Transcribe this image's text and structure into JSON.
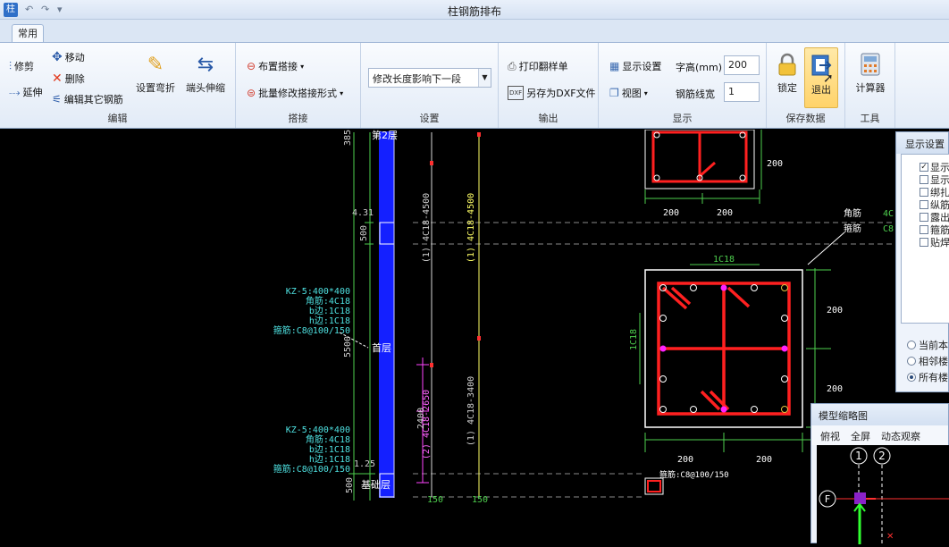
{
  "window": {
    "title": "柱钢筋排布"
  },
  "tabs": {
    "home": "常用"
  },
  "ribbon": {
    "edit": {
      "label": "编辑",
      "trim": "修剪",
      "move": "移动",
      "extend": "延伸",
      "delete": "删除",
      "edit_other": "编辑其它钢筋",
      "set_bend": "设置弯折",
      "end_stretch": "端头伸缩"
    },
    "lap": {
      "label": "搭接",
      "place": "布置搭接",
      "batch": "批量修改搭接形式"
    },
    "settings": {
      "label": "设置",
      "combo_value": "修改长度影响下一段"
    },
    "output": {
      "label": "输出",
      "print": "打印翻样单",
      "save_dxf": "另存为DXF文件"
    },
    "display": {
      "label": "显示",
      "show_settings": "显示设置",
      "view": "视图",
      "font_height_label": "字高(mm)",
      "font_height": "200",
      "line_width_label": "钢筋线宽",
      "line_width": "1"
    },
    "save": {
      "label": "保存数据",
      "lock": "锁定",
      "exit": "退出"
    },
    "tools": {
      "label": "工具",
      "calculator": "计算器"
    }
  },
  "display_panel": {
    "title": "显示设置",
    "items": [
      "显示",
      "显示",
      "绑扎",
      "纵筋",
      "露出",
      "箍筋",
      "贴焊"
    ],
    "first_checked": true,
    "radios": [
      "当前本",
      "相邻楼",
      "所有楼"
    ],
    "selected_radio": 2
  },
  "thumbnail": {
    "title": "模型缩略图",
    "menu": [
      "俯视",
      "全屏",
      "动态观察"
    ],
    "axes": [
      "1",
      "2",
      "F"
    ]
  },
  "cad": {
    "dims_left": [
      "385",
      "500",
      "5500",
      "4.31",
      "1.25",
      "500"
    ],
    "floor_labels": [
      "第2层",
      "首层",
      "基础层"
    ],
    "info1": [
      "KZ-5:400*400",
      "角筋:4C18",
      "b边:1C18",
      "h边:1C18",
      "箍筋:C8@100/150"
    ],
    "info2": [
      "KZ-5:400*400",
      "角筋:4C18",
      "b边:1C18",
      "h边:1C18",
      "箍筋:C8@100/150"
    ],
    "bar_labels": [
      "(1) 4C18-4500",
      "(1) 4C18-4500",
      "(1) 4C18-3400",
      "(2) 4C18-2650",
      "2400"
    ],
    "bottom": [
      "150",
      "150"
    ],
    "section_dims": [
      "200",
      "200",
      "200",
      "200",
      "200",
      "200",
      "200"
    ],
    "section_labels": [
      "1C18",
      "1C18",
      "角筋",
      "箍筋",
      "4C",
      "C8"
    ],
    "small_label": "箍筋:C8@100/150"
  }
}
